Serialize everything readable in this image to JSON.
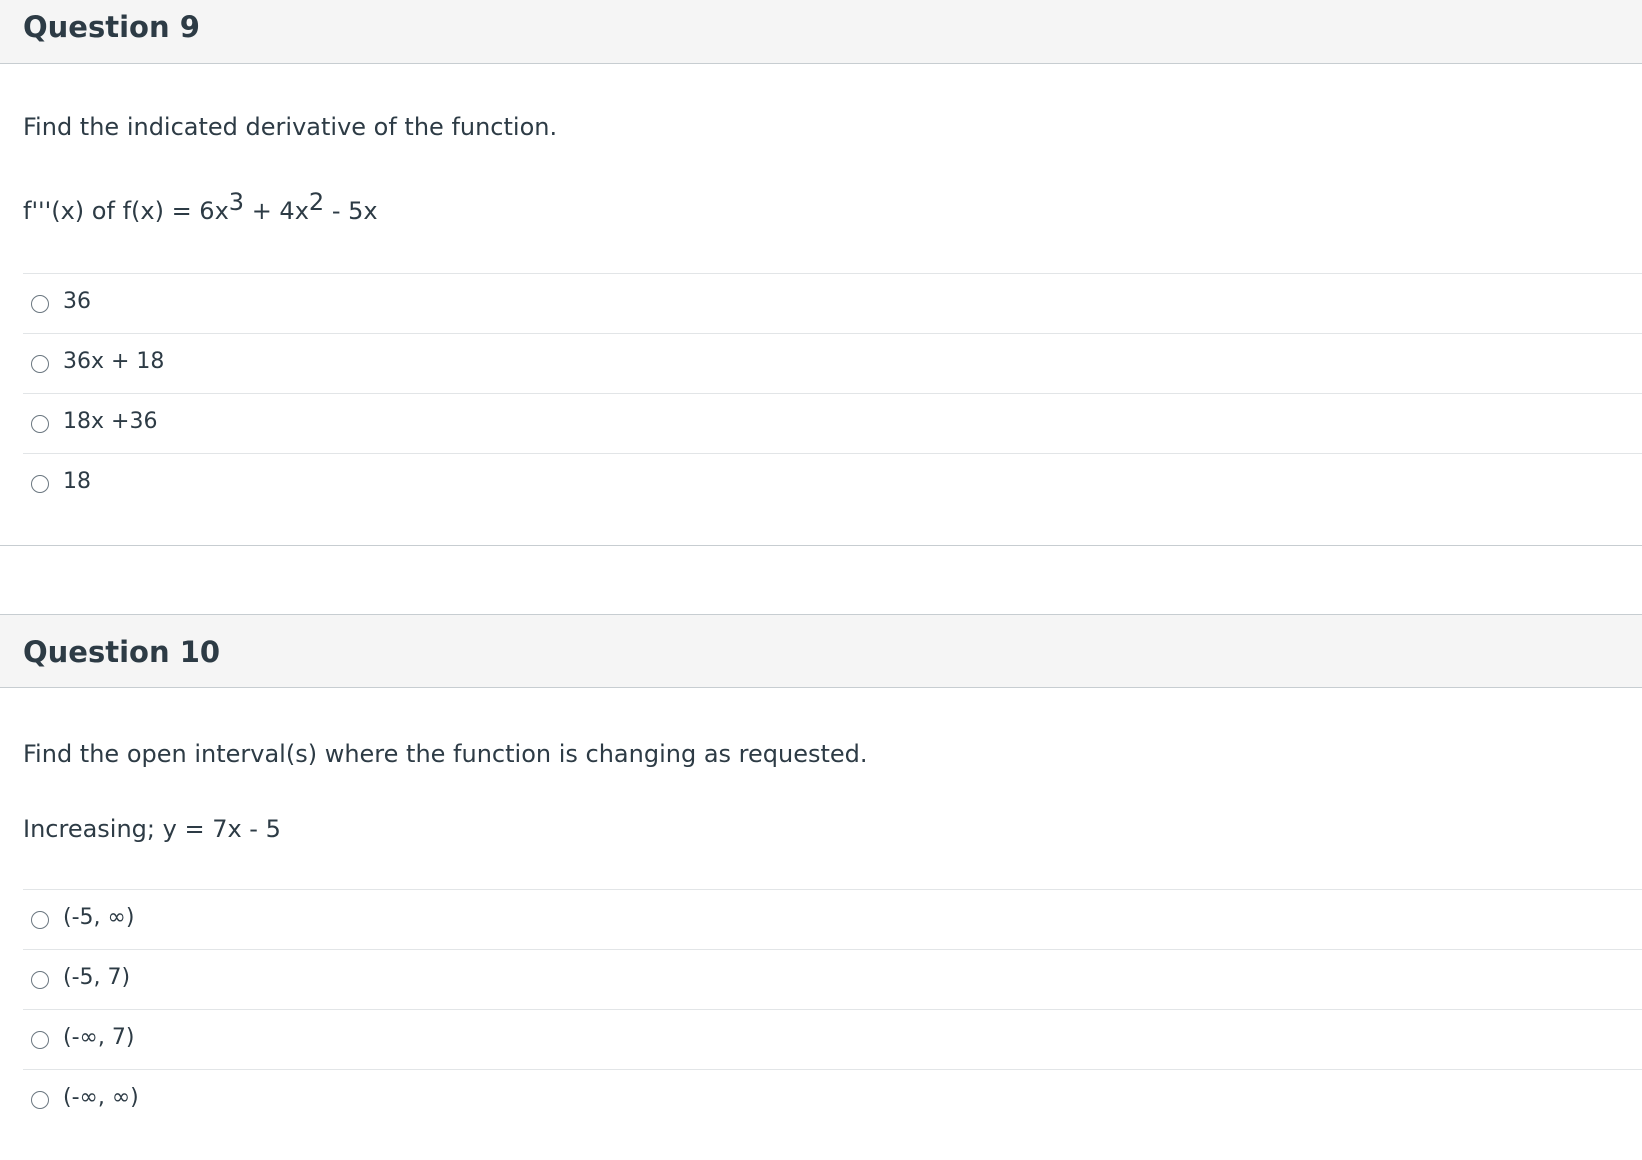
{
  "questions": [
    {
      "title": "Question 9",
      "prompt": "Find the indicated derivative of the function.",
      "expression": {
        "part1": "f'''(x) of f(x) = 6x",
        "sup1": "3",
        "part2": " + 4x",
        "sup2": "2",
        "part3": " - 5x"
      },
      "answers": [
        "36",
        "36x + 18",
        "18x +36",
        "18"
      ]
    },
    {
      "title": "Question 10",
      "prompt": "Find the open interval(s) where the function is changing as requested.",
      "expression": {
        "part1": "Increasing; y = 7x - 5"
      },
      "answers": [
        "(-5, ∞)",
        "(-5, 7)",
        "(-∞, 7)",
        "(-∞, ∞)"
      ]
    }
  ]
}
